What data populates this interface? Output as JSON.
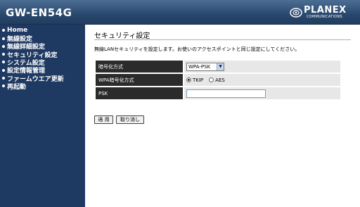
{
  "header": {
    "product": "GW-EN54G",
    "brand": "PLANEX",
    "brand_sub": "COMMUNICATIONS"
  },
  "sidebar": {
    "items": [
      {
        "label": "Home"
      },
      {
        "label": "無線設定"
      },
      {
        "label": "無線詳細設定"
      },
      {
        "label": "セキュリティ設定"
      },
      {
        "label": "システム設定"
      },
      {
        "label": "設定情報管理"
      },
      {
        "label": "ファームウエア更新"
      },
      {
        "label": "再起動"
      }
    ]
  },
  "main": {
    "title": "セキュリティ設定",
    "description": "無線LANセキュリティを設定します。お使いのアクセスポイントと同じ設定にしてください。",
    "form": {
      "encryption_label": "暗号化方式",
      "encryption_value": "WPA-PSK",
      "wpa_label": "WPA暗号化方式",
      "wpa_options": [
        "TKIP",
        "AES"
      ],
      "wpa_selected": "TKIP",
      "psk_label": "PSK",
      "psk_value": ""
    },
    "buttons": {
      "apply": "適 用",
      "cancel": "取り消し"
    }
  }
}
